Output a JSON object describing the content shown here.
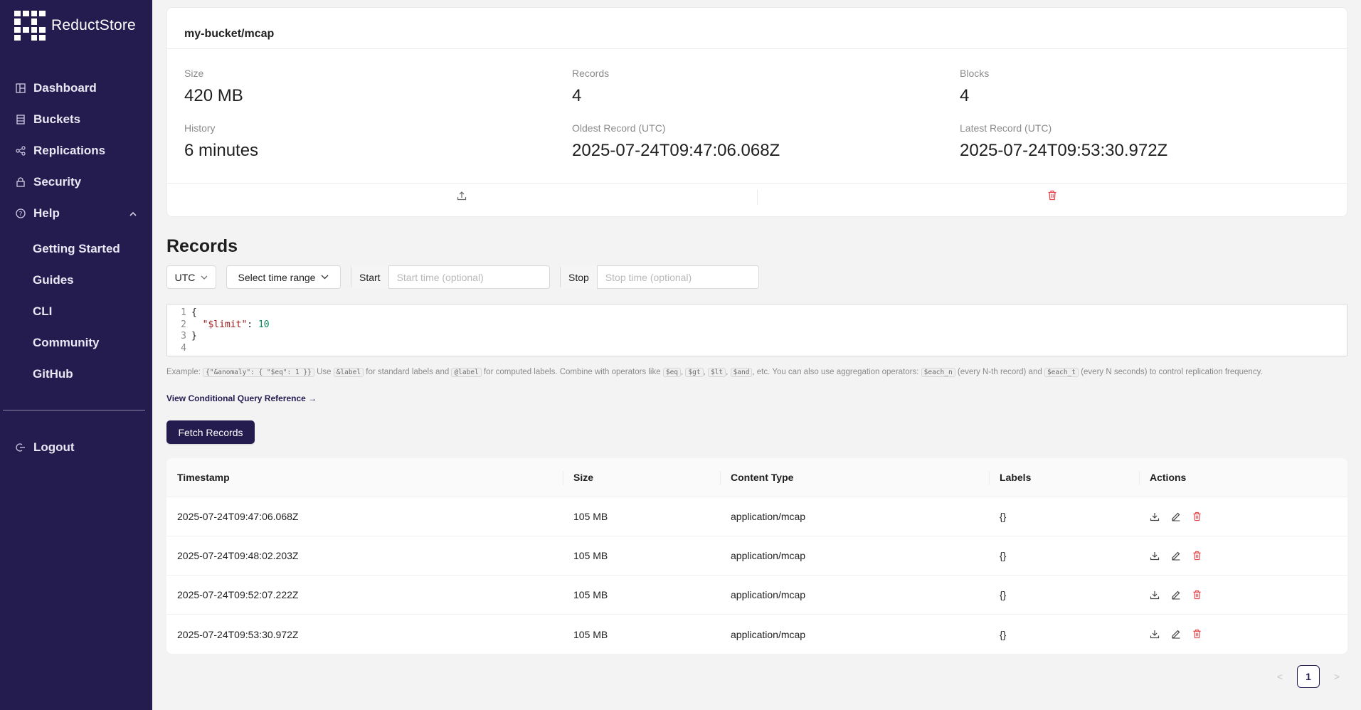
{
  "app": {
    "brand": "ReductStore"
  },
  "sidebar": {
    "items": [
      {
        "label": "Dashboard",
        "icon": "dashboard-icon"
      },
      {
        "label": "Buckets",
        "icon": "database-icon"
      },
      {
        "label": "Replications",
        "icon": "share-icon"
      },
      {
        "label": "Security",
        "icon": "lock-icon"
      },
      {
        "label": "Help",
        "icon": "question-circle-icon"
      }
    ],
    "help_subitems": [
      "Getting Started",
      "Guides",
      "CLI",
      "Community",
      "GitHub"
    ],
    "logout": {
      "label": "Logout",
      "icon": "logout-icon"
    }
  },
  "bucket": {
    "title": "my-bucket/mcap",
    "stats": [
      {
        "key": "Size",
        "value": "420 MB"
      },
      {
        "key": "Records",
        "value": "4"
      },
      {
        "key": "Blocks",
        "value": "4"
      },
      {
        "key": "History",
        "value": "6 minutes"
      },
      {
        "key": "Oldest Record (UTC)",
        "value": "2025-07-24T09:47:06.068Z"
      },
      {
        "key": "Latest Record (UTC)",
        "value": "2025-07-24T09:53:30.972Z"
      }
    ],
    "actions": {
      "upload_icon": "upload-icon",
      "delete_icon": "delete-icon"
    }
  },
  "records": {
    "title": "Records",
    "timezone": "UTC",
    "time_range": "Select time range",
    "start_label": "Start",
    "start_placeholder": "Start time (optional)",
    "stop_label": "Stop",
    "stop_placeholder": "Stop time (optional)",
    "editor": {
      "line_numbers": [
        "1",
        "2",
        "3",
        "4"
      ],
      "open_brace": "{",
      "key": "\"$limit\"",
      "colon": ": ",
      "value": "10",
      "close_brace": "}"
    },
    "help": {
      "example_label": "Example:",
      "example_code": "{\"&anomaly\": { \"$eq\": 1 }}",
      "use": "Use",
      "label_code": "&label",
      "std_labels": "for standard labels and",
      "computed_code": "@label",
      "computed_text": "for computed labels. Combine with operators like",
      "op_eq": "$eq",
      "op_gt": "$gt",
      "op_lt": "$lt",
      "op_and": "$and",
      "etc_text": ", etc. You can also use aggregation operators:",
      "each_n": "$each_n",
      "each_n_text": "(every N-th record) and",
      "each_t": "$each_t",
      "each_t_text": "(every N seconds) to control replication frequency.",
      "link": "View Conditional Query Reference →"
    },
    "fetch_label": "Fetch Records",
    "table": {
      "headers": [
        "Timestamp",
        "Size",
        "Content Type",
        "Labels",
        "Actions"
      ],
      "rows": [
        {
          "timestamp": "2025-07-24T09:47:06.068Z",
          "size": "105 MB",
          "content_type": "application/mcap",
          "labels": "{}"
        },
        {
          "timestamp": "2025-07-24T09:48:02.203Z",
          "size": "105 MB",
          "content_type": "application/mcap",
          "labels": "{}"
        },
        {
          "timestamp": "2025-07-24T09:52:07.222Z",
          "size": "105 MB",
          "content_type": "application/mcap",
          "labels": "{}"
        },
        {
          "timestamp": "2025-07-24T09:53:30.972Z",
          "size": "105 MB",
          "content_type": "application/mcap",
          "labels": "{}"
        }
      ]
    },
    "pagination": {
      "prev": "<",
      "current": "1",
      "next": ">"
    }
  },
  "colors": {
    "sidebar_bg": "#241b4f",
    "danger": "#e5484d",
    "primary": "#241b4f"
  }
}
